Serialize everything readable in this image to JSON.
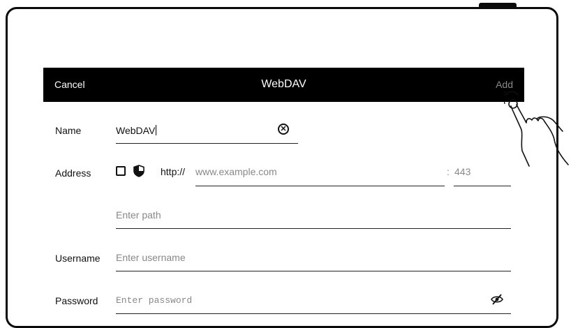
{
  "dialog": {
    "cancel_label": "Cancel",
    "title": "WebDAV",
    "add_label": "Add"
  },
  "form": {
    "name": {
      "label": "Name",
      "value": "WebDAV",
      "clear_icon": "clear-circle-icon"
    },
    "address": {
      "label": "Address",
      "https_checked": false,
      "shield_icon": "shield-icon",
      "protocol": "http://",
      "host_placeholder": "www.example.com",
      "port_separator": ":",
      "port_placeholder": "443"
    },
    "path": {
      "placeholder": "Enter path"
    },
    "username": {
      "label": "Username",
      "placeholder": "Enter username"
    },
    "password": {
      "label": "Password",
      "placeholder": "Enter password",
      "visibility_icon": "eye-off-icon"
    }
  },
  "colors": {
    "titlebar_bg": "#000000",
    "add_disabled": "#8a8a8a",
    "placeholder": "#888888"
  }
}
